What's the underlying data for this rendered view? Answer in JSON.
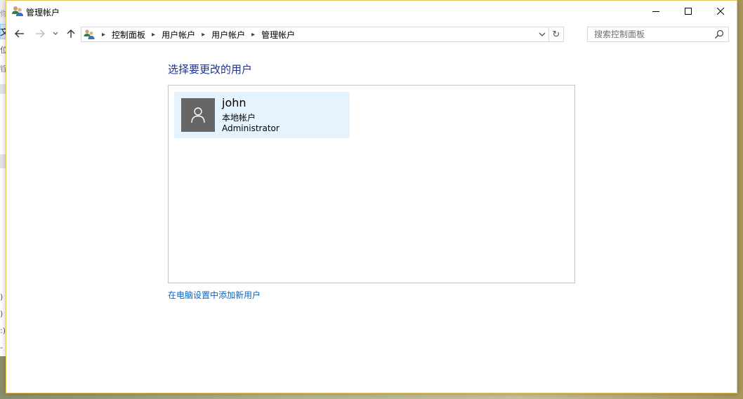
{
  "background_window": {
    "glyphs": [
      "你",
      "文",
      "位",
      "锃",
      ")",
      ")",
      ":)",
      "-"
    ]
  },
  "window": {
    "title": "管理帐户",
    "accent_color": "#e8c35a"
  },
  "nav": {
    "breadcrumbs": [
      "控制面板",
      "用户帐户",
      "用户帐户",
      "管理帐户"
    ],
    "refresh_glyph": "↻"
  },
  "search": {
    "placeholder": "搜索控制面板",
    "value": ""
  },
  "main": {
    "heading": "选择要更改的用户",
    "heading_color": "#1e3287",
    "users": [
      {
        "name": "john",
        "account_type": "本地帐户",
        "role": "Administrator",
        "avatar_icon": "user-silhouette-icon"
      }
    ],
    "add_user_link": "在电脑设置中添加新用户",
    "link_color": "#0066cc",
    "selection_color": "#e5f3ff"
  }
}
